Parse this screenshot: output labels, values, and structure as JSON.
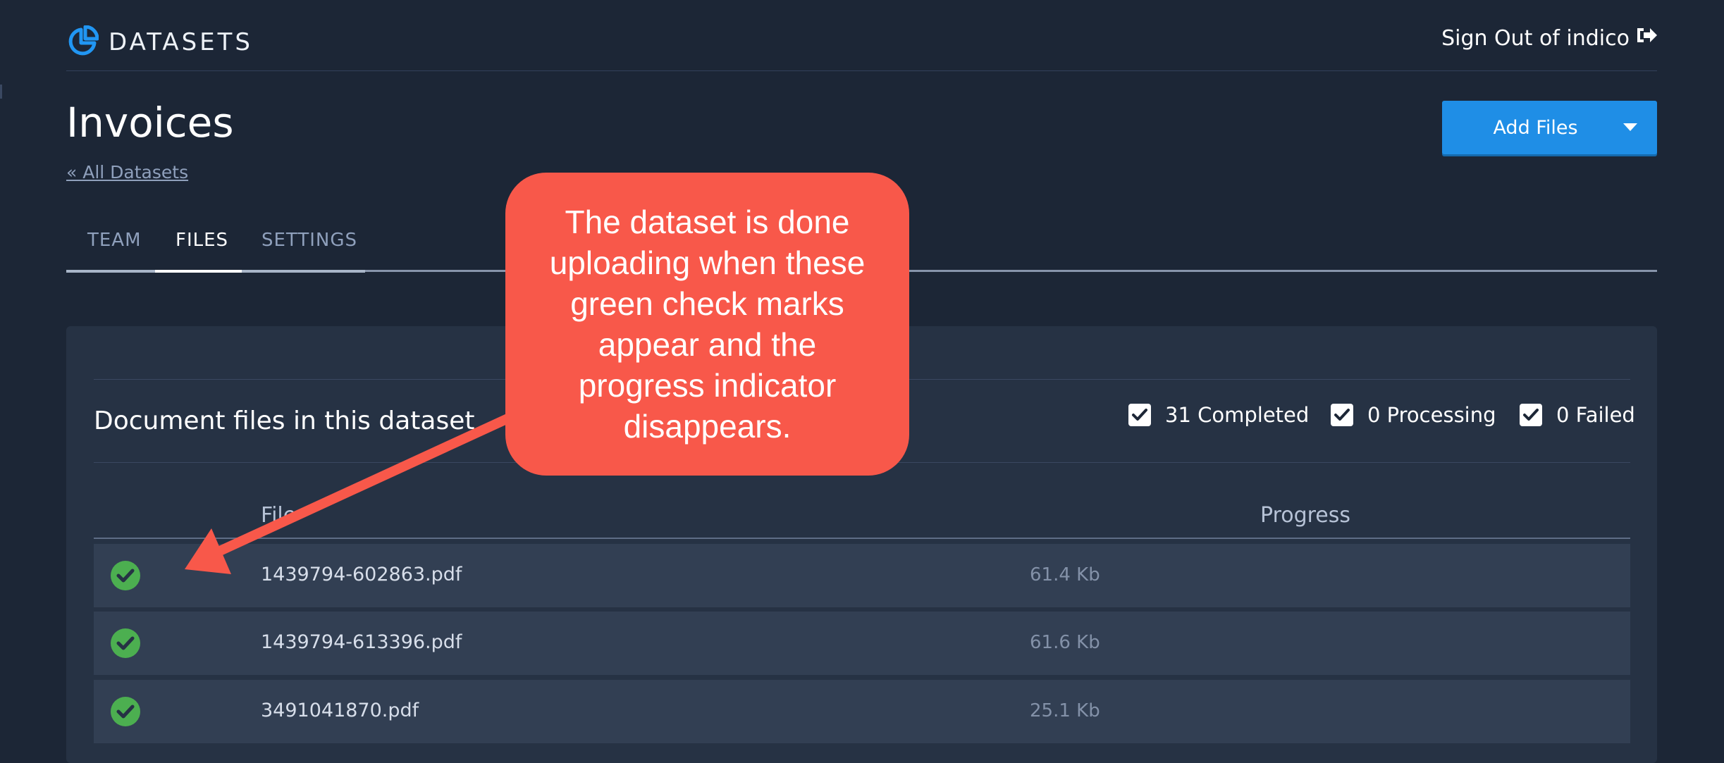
{
  "header": {
    "logo_icon": "pie-chart-icon",
    "logo_text": "DATASETS",
    "signout_label": "Sign Out of indico",
    "signout_icon": "sign-out-icon"
  },
  "page": {
    "title": "Invoices",
    "back_link": "« All Datasets",
    "add_files_label": "Add Files",
    "add_files_icon": "caret-down-icon"
  },
  "tabs": [
    {
      "label": "TEAM",
      "active": false
    },
    {
      "label": "FILES",
      "active": true
    },
    {
      "label": "SETTINGS",
      "active": false
    }
  ],
  "panel": {
    "title": "Document files in this dataset",
    "filters": [
      {
        "label": "31 Completed",
        "checked": true
      },
      {
        "label": "0 Processing",
        "checked": true
      },
      {
        "label": "0 Failed",
        "checked": true
      }
    ],
    "columns": [
      "File",
      "Progress"
    ],
    "rows": [
      {
        "status": "check-circle-icon",
        "name": "1439794-602863.pdf",
        "size": "61.4 Kb"
      },
      {
        "status": "check-circle-icon",
        "name": "1439794-613396.pdf",
        "size": "61.6 Kb"
      },
      {
        "status": "check-circle-icon",
        "name": "3491041870.pdf",
        "size": "25.1 Kb"
      }
    ]
  },
  "callout": {
    "text": "The dataset is done uploading when these green check marks appear and the progress indicator disappears.",
    "color": "#f8584a"
  },
  "colors": {
    "background": "#1c2636",
    "panel": "#263244",
    "row": "#323f53",
    "accent": "#1f8ee6",
    "success": "#4caf50",
    "logo": "#2196f3"
  }
}
